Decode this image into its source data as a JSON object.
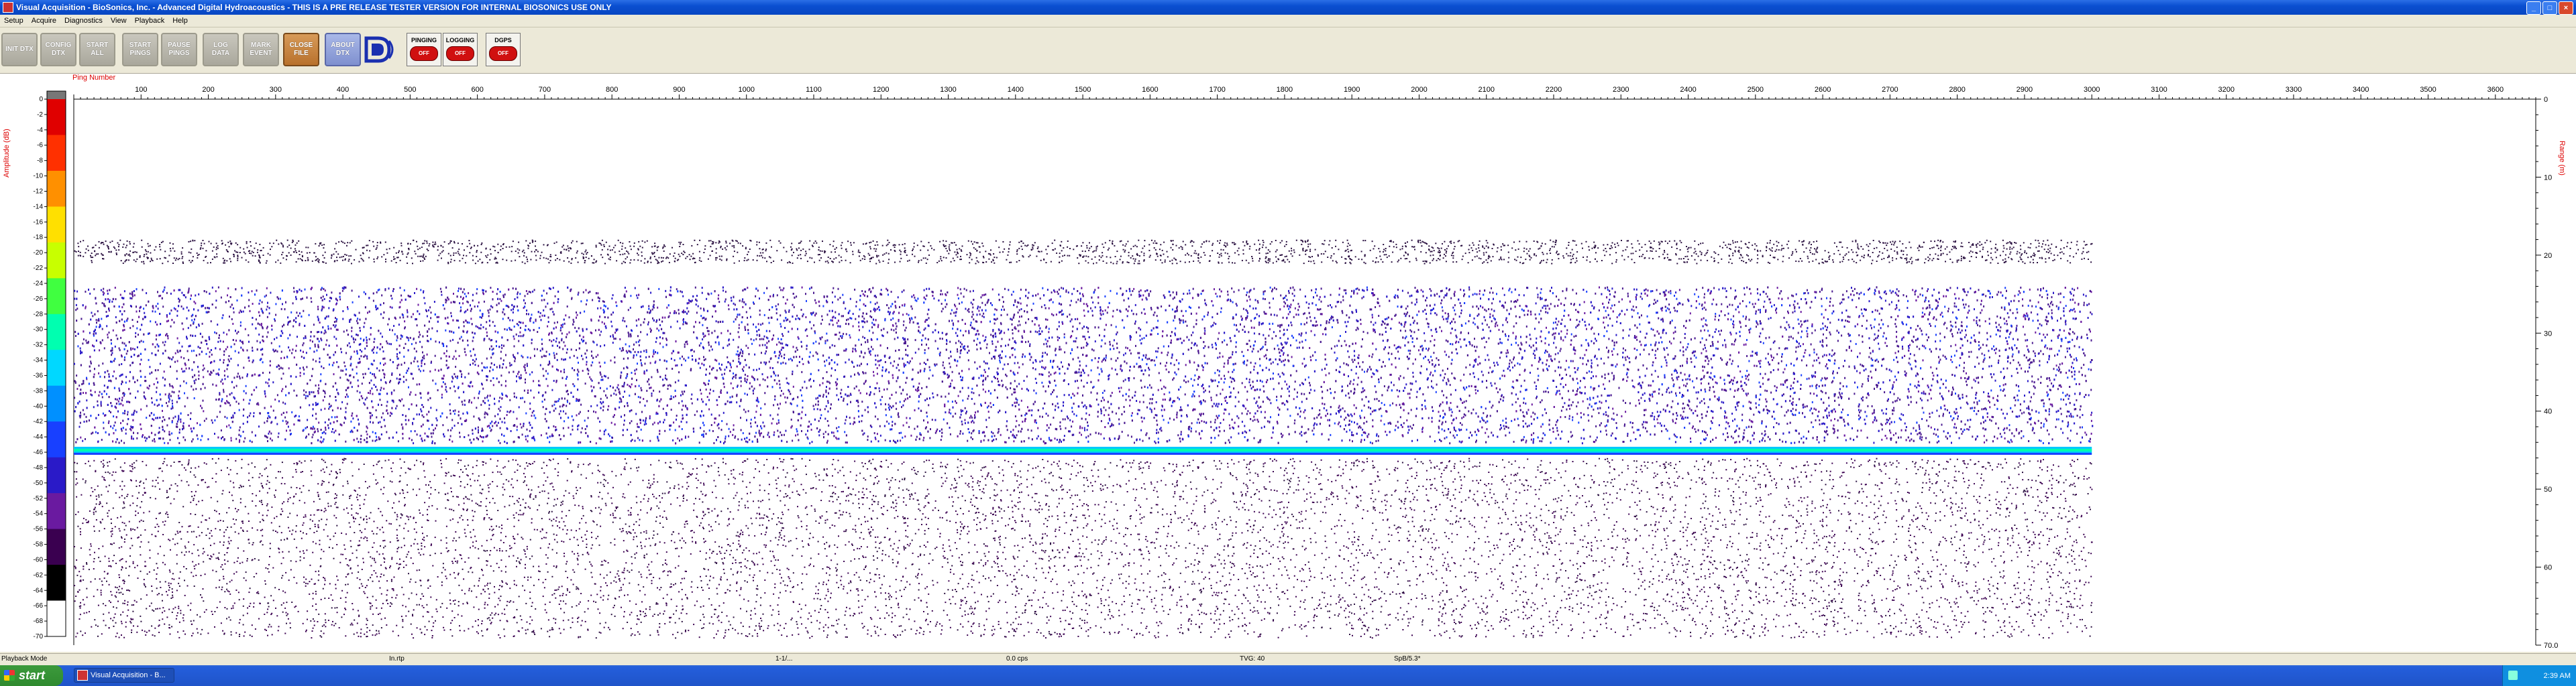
{
  "window": {
    "title": "Visual Acquisition  -  BioSonics, Inc.  -  Advanced Digital Hydroacoustics  -  THIS IS A PRE RELEASE TESTER VERSION FOR INTERNAL BIOSONICS USE ONLY",
    "buttons": [
      "_",
      "□",
      "×"
    ]
  },
  "menu": [
    "Setup",
    "Acquire",
    "Diagnostics",
    "View",
    "Playback",
    "Help"
  ],
  "toolbar": {
    "buttons": [
      {
        "label": "INIT DTX"
      },
      {
        "label": "CONFIG DTX"
      },
      {
        "label": "START ALL"
      },
      {
        "label": "START PINGS"
      },
      {
        "label": "PAUSE PINGS"
      },
      {
        "label": "LOG DATA"
      },
      {
        "label": "MARK EVENT"
      },
      {
        "label": "CLOSE FILE"
      },
      {
        "label": "ABOUT DTX"
      }
    ],
    "logo_icon": "biosonics-logo-icon",
    "status": [
      {
        "label": "PINGING",
        "value": "OFF"
      },
      {
        "label": "LOGGING",
        "value": "OFF"
      },
      {
        "label": "DGPS",
        "value": "OFF"
      }
    ]
  },
  "plot": {
    "x_title": "Ping Number",
    "left_title": "Amplitude (dB)",
    "right_title": "Range (m)",
    "x_ticks": [
      "100",
      "200",
      "300",
      "400",
      "500",
      "600",
      "700",
      "800",
      "900",
      "1000",
      "1100",
      "1200",
      "1300",
      "1400",
      "1500",
      "1600",
      "1700",
      "1800",
      "1900",
      "2000",
      "2100",
      "2200",
      "2300",
      "2400",
      "2500",
      "2600",
      "2700",
      "2800",
      "2900",
      "3000",
      "3100",
      "3200",
      "3300",
      "3400",
      "3500",
      "3600"
    ],
    "x_tick_values": [
      100,
      200,
      300,
      400,
      500,
      600,
      700,
      800,
      900,
      1000,
      1100,
      1200,
      1300,
      1400,
      1500,
      1600,
      1700,
      1800,
      1900,
      2000,
      2100,
      2200,
      2300,
      2400,
      2500,
      2600,
      2700,
      2800,
      2900,
      3000,
      3100,
      3200,
      3300,
      3400,
      3500,
      3600
    ],
    "x_range": [
      0,
      3660
    ],
    "data_end_ping": 3000,
    "amplitude_ticks": [
      "0",
      "-2",
      "-4",
      "-6",
      "-8",
      "-10",
      "-12",
      "-14",
      "-16",
      "-18",
      "-20",
      "-22",
      "-24",
      "-26",
      "-28",
      "-30",
      "-32",
      "-34",
      "-36",
      "-38",
      "-40",
      "-42",
      "-44",
      "-46",
      "-48",
      "-50",
      "-52",
      "-54",
      "-56",
      "-58",
      "-60",
      "-62",
      "-64",
      "-66",
      "-68",
      "-70"
    ],
    "range_ticks": [
      "0",
      "10",
      "20",
      "30",
      "40",
      "50",
      "60",
      "70.0"
    ],
    "range_values": [
      0,
      10,
      20,
      30,
      40,
      50,
      60,
      70
    ],
    "range_max": 70,
    "bottom_range_m": 45,
    "colors": [
      "#ffffff",
      "#000000",
      "#3a0050",
      "#6a1aa0",
      "#2a1ac8",
      "#1840ff",
      "#0090ff",
      "#00d8ff",
      "#00ffb0",
      "#40ff40",
      "#c8ff00",
      "#ffe000",
      "#ff9000",
      "#ff3000",
      "#e00000"
    ]
  },
  "statusbar": [
    "Playback Mode",
    "In.rtp",
    "1-1/...",
    "0.0 cps",
    "TVG: 40",
    "SpB/5.3*"
  ],
  "taskbar": {
    "start_label": "start",
    "task_label": "Visual Acquisition  -  B...",
    "clock": "2:39 AM"
  }
}
